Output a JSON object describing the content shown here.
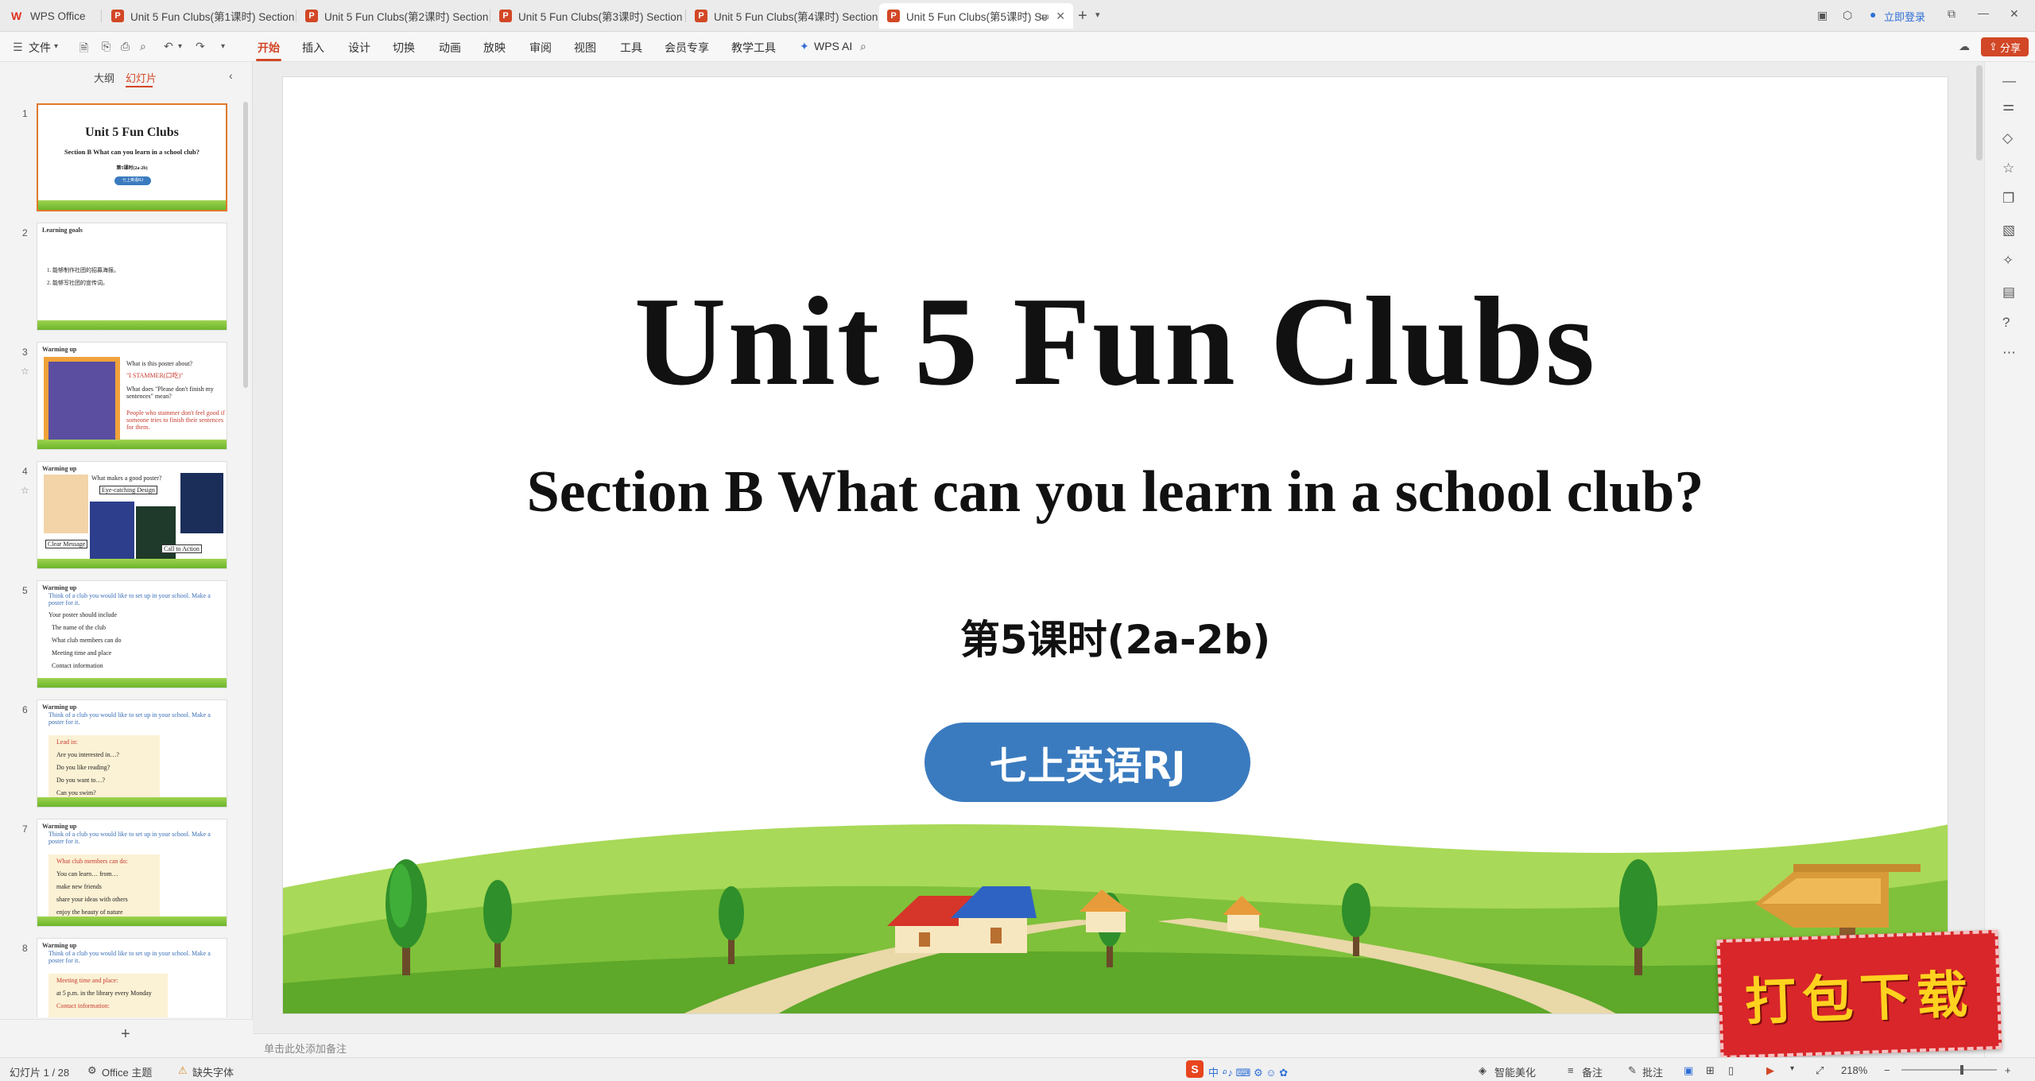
{
  "tabs": {
    "home": "WPS Office",
    "items": [
      "Unit 5 Fun Clubs(第1课时) Section",
      "Unit 5 Fun Clubs(第2课时) Section",
      "Unit 5 Fun Clubs(第3课时) Section",
      "Unit 5 Fun Clubs(第4课时) Section",
      "Unit 5 Fun Clubs(第5课时) Se"
    ],
    "new_tab": "+",
    "login": "立即登录"
  },
  "menu": {
    "file": "文件",
    "items": [
      "开始",
      "插入",
      "设计",
      "切换",
      "动画",
      "放映",
      "审阅",
      "视图",
      "工具",
      "会员专享",
      "教学工具"
    ],
    "ai": "WPS AI",
    "share": "分享"
  },
  "left_panel": {
    "tab_outline": "大纲",
    "tab_slides": "幻灯片",
    "add": "+",
    "thumbs": [
      {
        "num": "1",
        "title": "Unit 5 Fun Clubs",
        "sub": "Section B What can you learn in a school club?",
        "lesson": "第5课时(2a-2b)",
        "badge": "七上英语RJ"
      },
      {
        "num": "2",
        "head": "Learning goals",
        "l1": "1. 能够制作社团的招募海报。",
        "l2": "2. 能够写社团的宣传词。"
      },
      {
        "num": "3",
        "head": "Warming up",
        "q1": "What is this poster about?",
        "q2": "\"I STAMMER(口吃)\"",
        "q3": "What does \"Please don't finish my sentences\" mean?",
        "q4": "People who stammer don't feel good if someone tries to finish their sentences for them."
      },
      {
        "num": "4",
        "head": "Warming up",
        "q1": "What makes a good poster?",
        "c1": "Eye-catching Design",
        "c2": "Clear Message",
        "c3": "Call to Action"
      },
      {
        "num": "5",
        "head": "Warming up",
        "q1": "Think of a club you would like to set up in your school. Make a poster for it.",
        "l1": "Your poster should include",
        "l2": "The name of the club",
        "l3": "What club members can do",
        "l4": "Meeting time and place",
        "l5": "Contact information"
      },
      {
        "num": "6",
        "head": "Warming up",
        "q1": "Think of a club you would like to set up in your school. Make a poster for it.",
        "n0": "Lead in:",
        "n1": "Are you interested in…?",
        "n2": "Do you like reading?",
        "n3": "Do you want to…?",
        "n4": "Can you swim?"
      },
      {
        "num": "7",
        "head": "Warming up",
        "q1": "Think of a club you would like to set up in your school. Make a poster for it.",
        "n0": "What club members can do:",
        "n1": "You can learn… from…",
        "n2": "make new friends",
        "n3": "share your ideas with others",
        "n4": "enjoy the beauty of nature"
      },
      {
        "num": "8",
        "head": "Warming up",
        "q1": "Think of a club you would like to set up in your school. Make a poster for it.",
        "n0": "Meeting time and place:",
        "n1": "at 5 p.m. in the library every Monday",
        "n2": "Contact information:"
      }
    ]
  },
  "slide": {
    "title": "Unit 5 Fun Clubs",
    "subtitle": "Section B What can you learn in a school club?",
    "lesson": "第5课时(2a-2b)",
    "badge": "七上英语RJ"
  },
  "notes_placeholder": "单击此处添加备注",
  "status": {
    "slide_count": "幻灯片 1 / 28",
    "theme": "Office 主题",
    "missing_font": "缺失字体",
    "beautify": "智能美化",
    "notes": "备注",
    "comments": "批注",
    "zoom": "218%"
  },
  "promo": "打包下载",
  "colors": {
    "accent": "#d24726",
    "badge": "#3a7bbf",
    "promo": "#d8262a"
  }
}
